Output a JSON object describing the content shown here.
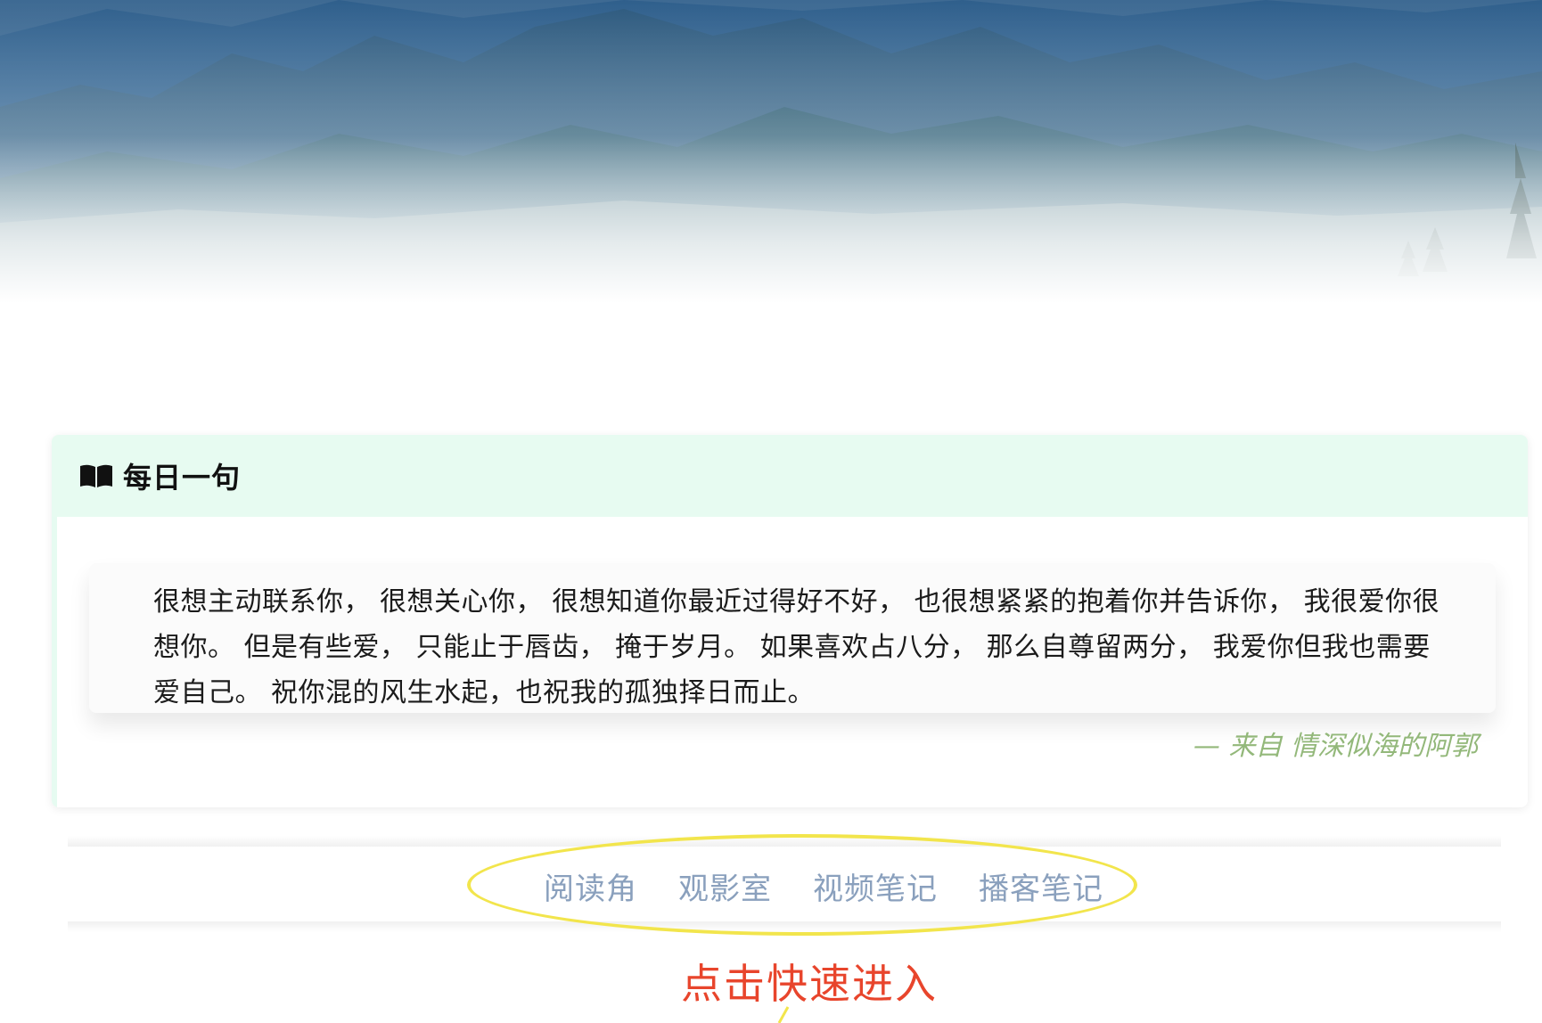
{
  "daily_quote": {
    "title": "每日一句",
    "text": "很想主动联系你， 很想关心你， 很想知道你最近过得好不好， 也很想紧紧的抱着你并告诉你， 我很爱你很想你。 但是有些爱， 只能止于唇齿， 掩于岁月。 如果喜欢占八分， 那么自尊留两分， 我爱你但我也需要爱自己。 祝你混的风生水起，也祝我的孤独择日而止。",
    "source": "— 来自 情深似海的阿郭"
  },
  "quick_nav": {
    "items": [
      {
        "label": "阅读角"
      },
      {
        "label": "观影室"
      },
      {
        "label": "视频笔记"
      },
      {
        "label": "播客笔记"
      }
    ]
  },
  "annotation": {
    "text": "点击快速进入"
  },
  "icons": {
    "header_icon": "book-open-icon"
  },
  "colors": {
    "header_bg": "#e7fbf1",
    "nav_link": "#8aa0bd",
    "source_text": "#93b87a",
    "annotation": "#e8452c",
    "highlight_ring": "#f2e54c"
  }
}
